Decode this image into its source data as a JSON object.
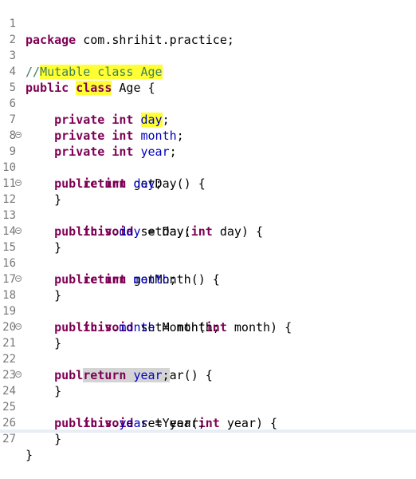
{
  "editor": {
    "fold_icon": "fold-collapse-icon",
    "colors": {
      "keyword": "#7f0055",
      "field": "#0000c0",
      "comment": "#3f7f5f",
      "highlight": "#ffff33"
    },
    "lines": [
      {
        "n": "1",
        "t": {
          "kw": "package",
          "rest": " com.shrihit.practice;"
        }
      },
      {
        "n": "2"
      },
      {
        "n": "3",
        "t": {
          "c1": "//",
          "c2": "Mutable class Age"
        }
      },
      {
        "n": "4",
        "t": {
          "kw1": "public",
          "sp": " ",
          "kw2": "class",
          "rest": " Age {"
        }
      },
      {
        "n": "5"
      },
      {
        "n": "6",
        "t": {
          "kw1": "private",
          "kw2": "int",
          "f": "day",
          "p": ";"
        }
      },
      {
        "n": "7",
        "t": {
          "kw1": "private",
          "kw2": "int",
          "f": "month",
          "p": ";"
        }
      },
      {
        "n": "8",
        "t": {
          "kw1": "private",
          "kw2": "int",
          "f": "year",
          "p": ";"
        }
      },
      {
        "n": "9",
        "t": {
          "kw1": "public",
          "kw2": "int",
          "rest": " getDay() {"
        }
      },
      {
        "n": "10",
        "t": {
          "kw": "return",
          "f": "day",
          "p": ";"
        }
      },
      {
        "n": "11",
        "t": {
          "rest": "}"
        }
      },
      {
        "n": "12",
        "t": {
          "kw1": "public",
          "kw2": "void",
          "m": " setDay(",
          "kw3": "int",
          "a": " day) {"
        }
      },
      {
        "n": "13",
        "t": {
          "kw": "this",
          "d": ".",
          "f": "day",
          "rest": " = day;"
        }
      },
      {
        "n": "14",
        "t": {
          "rest": "}"
        }
      },
      {
        "n": "15",
        "t": {
          "kw1": "public",
          "kw2": "int",
          "rest": " getMonth() {"
        }
      },
      {
        "n": "16",
        "t": {
          "kw": "return",
          "f": "month",
          "p": ";"
        }
      },
      {
        "n": "17",
        "t": {
          "rest": "}"
        }
      },
      {
        "n": "18",
        "t": {
          "kw1": "public",
          "kw2": "void",
          "m": " setMonth(",
          "kw3": "int",
          "a": " month) {"
        }
      },
      {
        "n": "19",
        "t": {
          "kw": "this",
          "d": ".",
          "f": "month",
          "rest": " = month;"
        }
      },
      {
        "n": "20",
        "t": {
          "rest": "}"
        }
      },
      {
        "n": "21",
        "t": {
          "kw1": "public",
          "kw2": "int",
          "rest": " getYear() {"
        }
      },
      {
        "n": "22",
        "t": {
          "kw": "return",
          "f": "year",
          "p": ";"
        }
      },
      {
        "n": "23",
        "t": {
          "rest": "}"
        }
      },
      {
        "n": "24",
        "t": {
          "kw1": "public",
          "kw2": "void",
          "m": " setYear(",
          "kw3": "int",
          "a": " year) {"
        }
      },
      {
        "n": "25",
        "t": {
          "kw": "this",
          "d": ".",
          "f": "year",
          "rest": " = year;"
        }
      },
      {
        "n": "26",
        "t": {
          "rest": "}"
        }
      },
      {
        "n": "27",
        "t": {
          "rest": "}"
        }
      }
    ]
  }
}
